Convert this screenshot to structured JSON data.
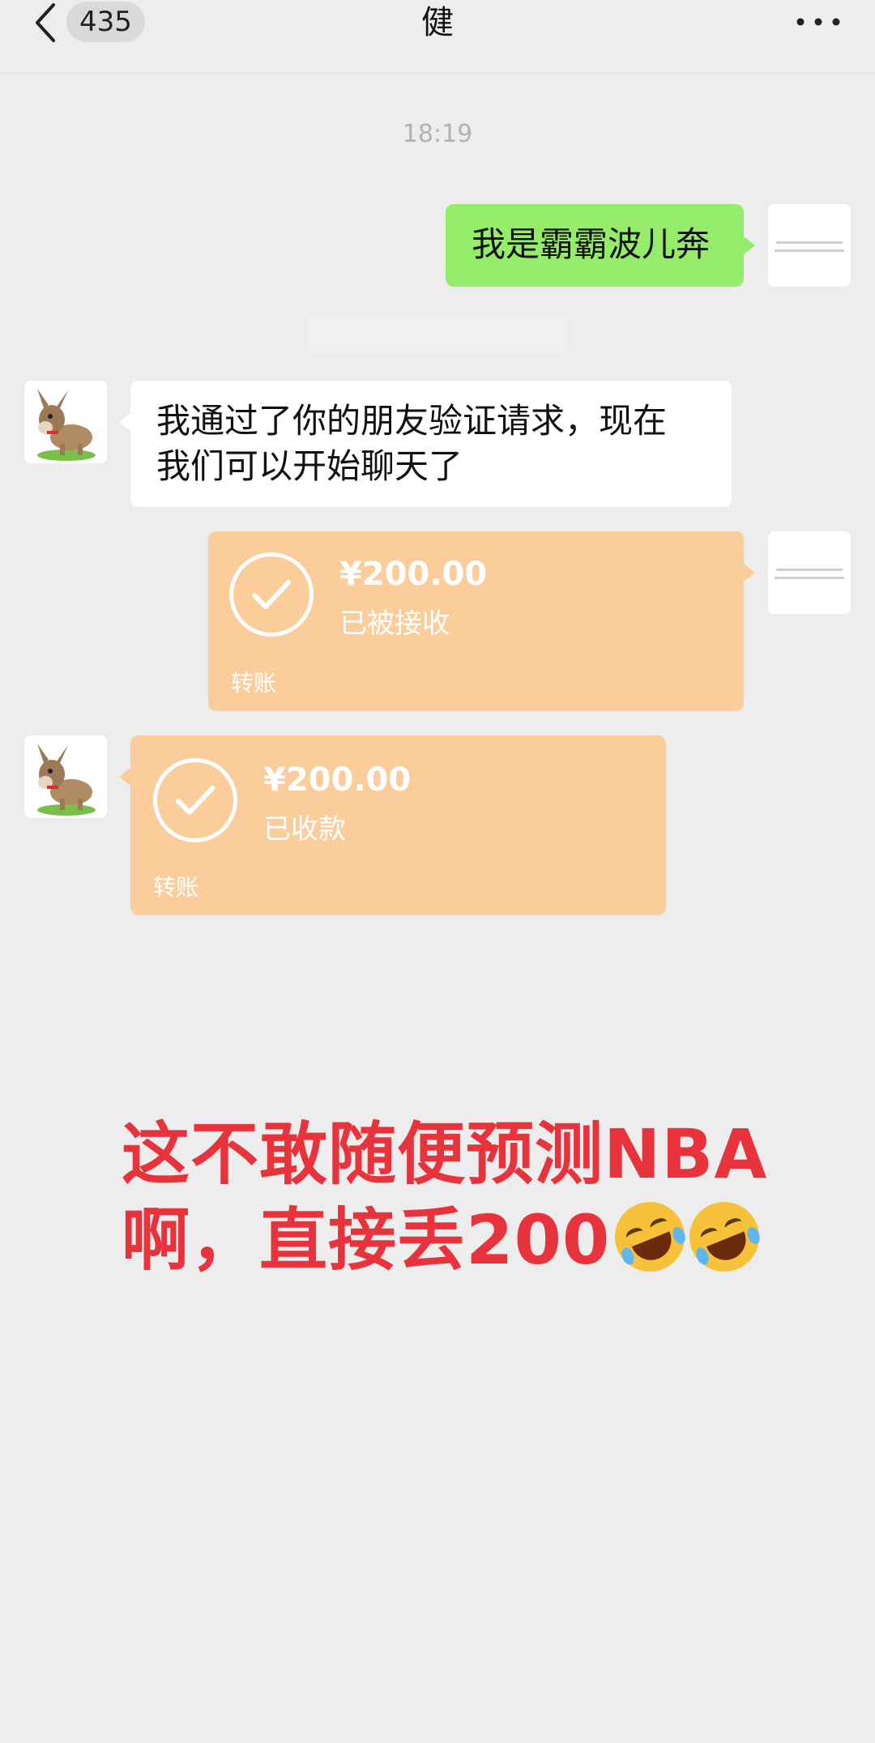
{
  "header": {
    "unread_count": "435",
    "title": "健"
  },
  "chat": {
    "timestamp": "18:19",
    "messages": [
      {
        "side": "right",
        "type": "text",
        "text": "我是霸霸波儿奔"
      },
      {
        "side": "left",
        "type": "text",
        "line1": "我通过了你的朋友验证请求，现在",
        "line2": "我们可以开始聊天了"
      },
      {
        "side": "right",
        "type": "transfer",
        "amount": "¥200.00",
        "status": "已被接收",
        "label": "转账"
      },
      {
        "side": "left",
        "type": "transfer",
        "amount": "¥200.00",
        "status": "已收款",
        "label": "转账"
      }
    ]
  },
  "overlay": {
    "line1": "这不敢随便预测NBA",
    "line2": "啊，直接丢200"
  },
  "colors": {
    "background": "#ededed",
    "green_bubble": "#95ec69",
    "transfer_bubble": "#fbcd9b",
    "overlay_text": "#e8333c"
  }
}
